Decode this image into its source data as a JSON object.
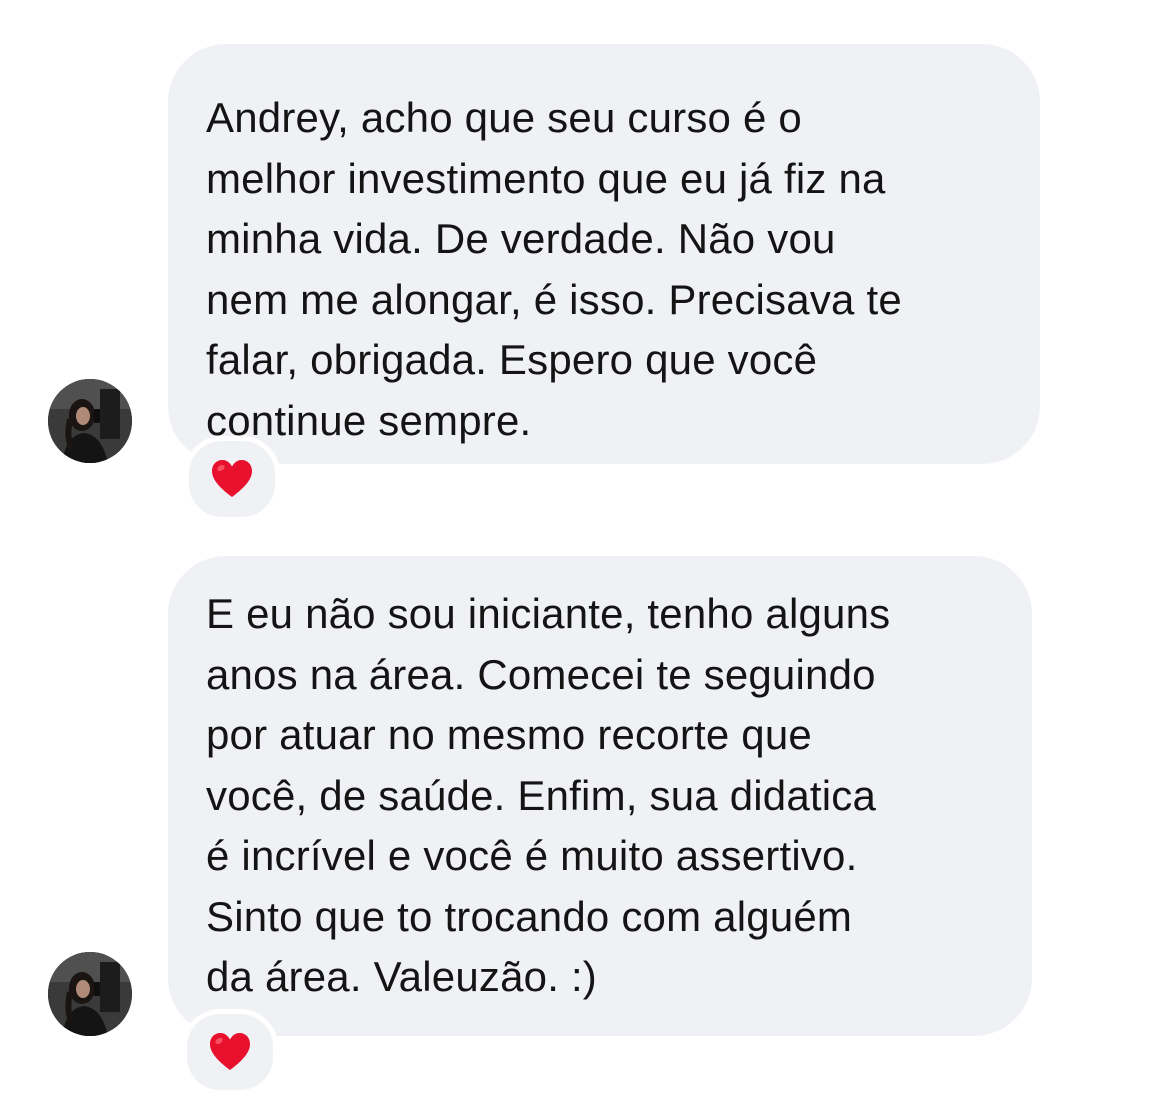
{
  "messages": [
    {
      "text": "Andrey, acho que seu curso é o\nmelhor investimento que eu já fiz na\nminha vida. De verdade. Não vou\nnem me alongar, é isso. Precisava te\nfalar, obrigada. Espero que você\ncontinue sempre.",
      "reaction": "heart-emoji",
      "avatar": "user-avatar"
    },
    {
      "text": "E eu não sou iniciante, tenho alguns\nanos na área. Comecei te seguindo\npor atuar no mesmo recorte que\nvocê, de saúde. Enfim, sua didatica\né incrível e você é muito assertivo.\nSinto que to trocando com alguém\nda área. Valeuzão. :)",
      "reaction": "heart-emoji",
      "avatar": "user-avatar"
    }
  ],
  "colors": {
    "bubble": "#eff1f4",
    "text": "#141414",
    "heart": "#e8112d",
    "background": "#ffffff"
  }
}
